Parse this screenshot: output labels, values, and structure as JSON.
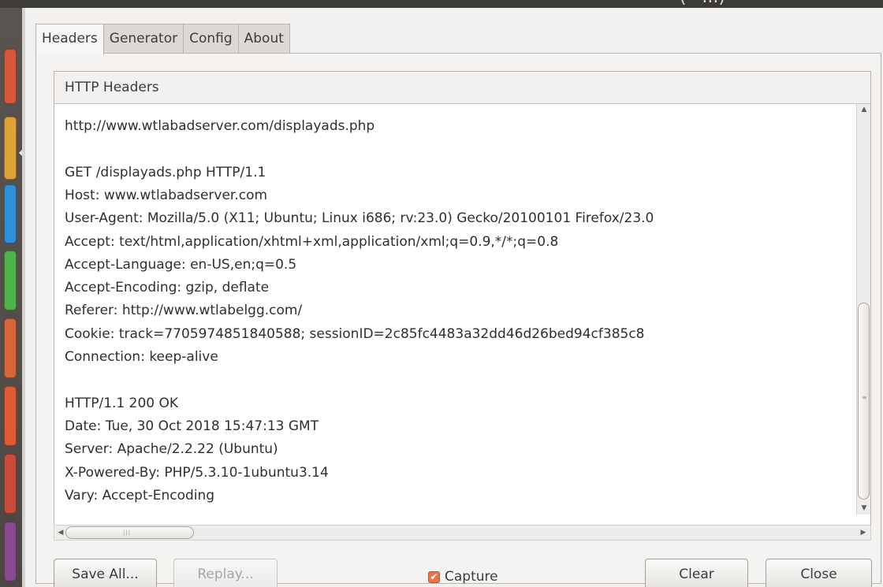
{
  "window": {
    "title": "(• ...)"
  },
  "tabs": [
    {
      "label": "Headers",
      "active": true
    },
    {
      "label": "Generator",
      "active": false
    },
    {
      "label": "Config",
      "active": false
    },
    {
      "label": "About",
      "active": false
    }
  ],
  "headers_panel": {
    "title": "HTTP Headers",
    "lines": [
      "http://www.wtlabadserver.com/displayads.php",
      "",
      "GET /displayads.php HTTP/1.1",
      "Host: www.wtlabadserver.com",
      "User-Agent: Mozilla/5.0 (X11; Ubuntu; Linux i686; rv:23.0) Gecko/20100101 Firefox/23.0",
      "Accept: text/html,application/xhtml+xml,application/xml;q=0.9,*/*;q=0.8",
      "Accept-Language: en-US,en;q=0.5",
      "Accept-Encoding: gzip, deflate",
      "Referer: http://www.wtlabelgg.com/",
      "Cookie: track=7705974851840588; sessionID=2c85fc4483a32dd46d26bed94cf385c8",
      "Connection: keep-alive",
      "",
      "HTTP/1.1 200 OK",
      "Date: Tue, 30 Oct 2018 15:47:13 GMT",
      "Server: Apache/2.2.22 (Ubuntu)",
      "X-Powered-By: PHP/5.3.10-1ubuntu3.14",
      "Vary: Accept-Encoding"
    ]
  },
  "buttons": {
    "save_all": "Save All...",
    "replay": "Replay...",
    "capture_label": "Capture",
    "capture_checked": true,
    "clear": "Clear",
    "close": "Close"
  },
  "icons": {
    "scroll_up": "▲",
    "scroll_down": "▼",
    "scroll_left": "◀",
    "scroll_right": "▶",
    "check": "✔"
  },
  "colors": {
    "checkbox_accent": "#e9734a",
    "launcher_tiles": [
      "#d8573a",
      "#e0a33a",
      "#2f8fd8",
      "#4fb34a",
      "#d9653b",
      "#e05a35",
      "#c94b3a",
      "#8a4a8f"
    ]
  }
}
